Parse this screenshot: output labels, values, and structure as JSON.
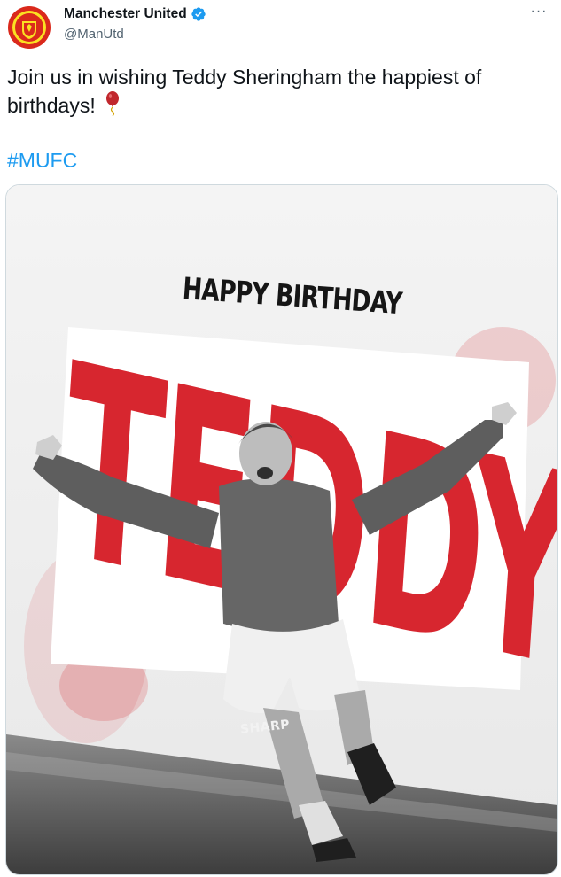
{
  "account": {
    "display_name": "Manchester United",
    "handle": "@ManUtd",
    "verified_icon": "verified-badge-icon",
    "avatar_icon": "club-crest-icon"
  },
  "menu": {
    "more_label": "···"
  },
  "tweet": {
    "text": "Join us in wishing Teddy Sheringham the happiest of birthdays!",
    "emoji_icon": "balloon-icon",
    "hashtag": "#MUFC"
  },
  "media": {
    "headline": "HAPPY BIRTHDAY",
    "name": "TEDDY",
    "shirt_sponsor": "SHARP",
    "colors": {
      "accent_red": "#d7262f",
      "link_blue": "#1d9bf0",
      "verified_blue": "#1d9bf0"
    }
  }
}
